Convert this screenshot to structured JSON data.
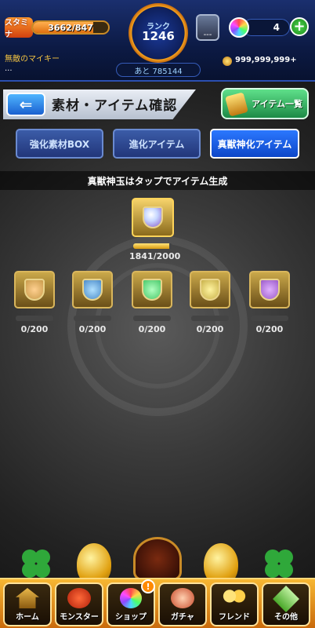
{
  "status": {
    "stamina_label": "スタミナ",
    "stamina_value": "3662",
    "stamina_max": "/847",
    "stamina_fraction": 0.8,
    "rank_label": "ランク",
    "rank_value": "1246",
    "next_exp": "あと 785144",
    "energy_label": "---",
    "orb_count": "4",
    "player_name": "無敵のマイキー",
    "player_sub": "...",
    "coins": "999,999,999+"
  },
  "header": {
    "title": "素材・アイテム確認",
    "item_list_label": "アイテム一覧"
  },
  "tabs": [
    {
      "label": "強化素材BOX",
      "active": false
    },
    {
      "label": "進化アイテム",
      "active": false
    },
    {
      "label": "真獣神化アイテム",
      "active": true
    }
  ],
  "hint": "真獣神玉はタップでアイテム生成",
  "main_item": {
    "count": "1841/2000",
    "fraction": 0.92
  },
  "items": [
    {
      "count": "0/200",
      "color": "#c89a4a"
    },
    {
      "count": "0/200",
      "color": "#4a8ac8"
    },
    {
      "count": "0/200",
      "color": "#4ac86a"
    },
    {
      "count": "0/200",
      "color": "#c8b04a"
    },
    {
      "count": "0/200",
      "color": "#9a5ac8"
    }
  ],
  "nav": [
    {
      "label": "ホーム",
      "icon": "home-icon"
    },
    {
      "label": "モンスター",
      "icon": "monster-icon"
    },
    {
      "label": "ショップ",
      "icon": "shop-orb-icon",
      "badge": "!"
    },
    {
      "label": "ガチャ",
      "icon": "gacha-icon"
    },
    {
      "label": "フレンド",
      "icon": "friends-icon"
    },
    {
      "label": "その他",
      "icon": "other-icon"
    }
  ]
}
